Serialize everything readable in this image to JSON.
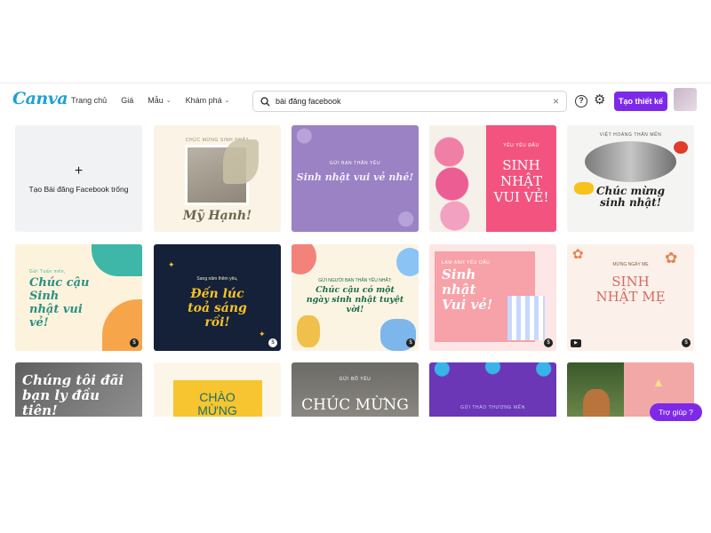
{
  "header": {
    "logo": "Canva",
    "nav": [
      "Trang chủ",
      "Giá",
      "Mẫu",
      "Khám phá"
    ],
    "search_value": "bài đăng facebook",
    "create_label": "Tạo thiết kế"
  },
  "blank_card": {
    "label": "Tạo Bài đăng Facebook trống"
  },
  "templates": {
    "t1": {
      "top": "CHÚC MỪNG SINH NHẬT",
      "name": "Mỹ Hạnh!"
    },
    "t2": {
      "top": "GỬI BẠN THÂN YÊU",
      "main": "Sinh nhật vui vẻ nhé!"
    },
    "t3": {
      "top": "YÊU YÊU ĐẤU",
      "main": "SINH NHẬT VUI VẺ!"
    },
    "t4": {
      "top": "VIỆT HOÀNG THÂN MẾN",
      "main": "Chúc mừng sinh nhật!"
    },
    "t5": {
      "top": "Gửi Tuấn mến,",
      "main": "Chúc cậu Sinh nhật vui vẻ!"
    },
    "t6": {
      "top": "Sang năm thêm yêu,",
      "main": "Đến lúc toả sáng rồi!"
    },
    "t7": {
      "top": "GỬI NGƯỜI BẠN THÂN YÊU NHẤT:",
      "main": "Chúc cậu có một ngày sinh nhật tuyệt vời!"
    },
    "t8": {
      "top": "LAM ANH YÊU DẤU",
      "main": "Sinh nhật Vui vẻ!"
    },
    "t9": {
      "top": "MỪNG NGÀY MẸ",
      "main": "SINH NHẬT MẸ"
    },
    "t10": {
      "main": "Chúng tôi đãi bạn ly đầu tiên!"
    },
    "t11": {
      "main": "CHÀO MỪNG NGÀY"
    },
    "t12": {
      "top": "GỬI BỐ YÊU",
      "main": "CHÚC MỪNG"
    },
    "t13": {
      "top": "GỬI THẢO THƯƠNG MẾN"
    }
  },
  "help_button": "Trợ giúp ?",
  "colors": {
    "accent": "#7d2ae8",
    "logo": "#1ea1d6"
  }
}
